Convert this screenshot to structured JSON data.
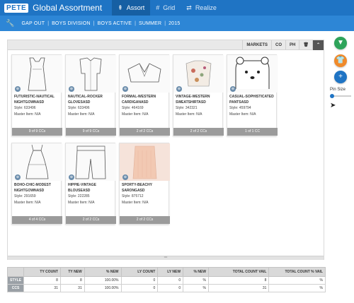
{
  "app": {
    "logo": "PETE",
    "title": "Global Assortment"
  },
  "nav": [
    {
      "icon": "⇞",
      "label": "Assort"
    },
    {
      "icon": "#",
      "label": "Grid"
    },
    {
      "icon": "⇄",
      "label": "Realize"
    }
  ],
  "breadcrumb": [
    "GAP OUT",
    "BOYS DIVISION",
    "BOYS ACTIVE",
    "SUMMER",
    "2015"
  ],
  "toolbar": {
    "markets": "MARKETS",
    "co": "CO",
    "ph": "PH",
    "trash": "🗑",
    "collapse": "⌃"
  },
  "cards": [
    {
      "name": "FUTURISTIC-NAUTICAL NIGHTGOWNASD",
      "style": "Style: 633496",
      "master": "Master Item: N/A",
      "footer": "9 of 9 CCs"
    },
    {
      "name": "NAUTICAL-ROCKER GLOVESASD",
      "style": "Style: 633496",
      "master": "Master Item: N/A",
      "footer": "9 of 9 CCs"
    },
    {
      "name": "FORMAL-WESTERN CARDIGANASD",
      "style": "Style: 464169",
      "master": "Master Item: N/A",
      "footer": "2 of 2 CCs"
    },
    {
      "name": "VINTAGE-WESTERN SWEATSHIRTASD",
      "style": "Style: 342321",
      "master": "Master Item: N/A",
      "footer": "2 of 2 CCs"
    },
    {
      "name": "CASUAL-SOPHISTICATED PANTSASD",
      "style": "Style: 459794",
      "master": "Master Item: N/A",
      "footer": "1 of 1 CC"
    },
    {
      "name": "BOHO-CHIC-MODEST NIGHTGOWNASD",
      "style": "Style: 291659",
      "master": "Master Item: N/A",
      "footer": "4 of 4 CCs"
    },
    {
      "name": "HIPPIE-VINTAGE BLOUSEASD",
      "style": "Style: 222285",
      "master": "Master Item: N/A",
      "footer": "2 of 2 CCs"
    },
    {
      "name": "SPORTY-BEACHY SARONGASD",
      "style": "Style: 875712",
      "master": "Master Item: N/A",
      "footer": "2 of 2 CCs"
    }
  ],
  "table": {
    "headers": [
      "",
      "TY COUNT",
      "TY NEW",
      "% NEW",
      "LY COUNT",
      "LY NEW",
      "% NEW",
      "TOTAL COUNT VAIL",
      "TOTAL COUNT % VAIL"
    ],
    "rows": [
      [
        "STYLE",
        "8",
        "8",
        "100.00%",
        "0",
        "0",
        "%",
        "8",
        "%"
      ],
      [
        "CCS",
        "31",
        "31",
        "100.00%",
        "0",
        "0",
        "%",
        "31",
        "%"
      ]
    ]
  },
  "rail": {
    "pin_size": "Pin Size",
    "filter_icon": "▼",
    "shirt_icon": "👕",
    "add_icon": "+"
  },
  "colors": {
    "topbar": "#1f74c4",
    "breadcrumb": "#2d86d6",
    "filter": "#2ea35a",
    "shirt": "#f08a2b",
    "add": "#1f74c4"
  }
}
